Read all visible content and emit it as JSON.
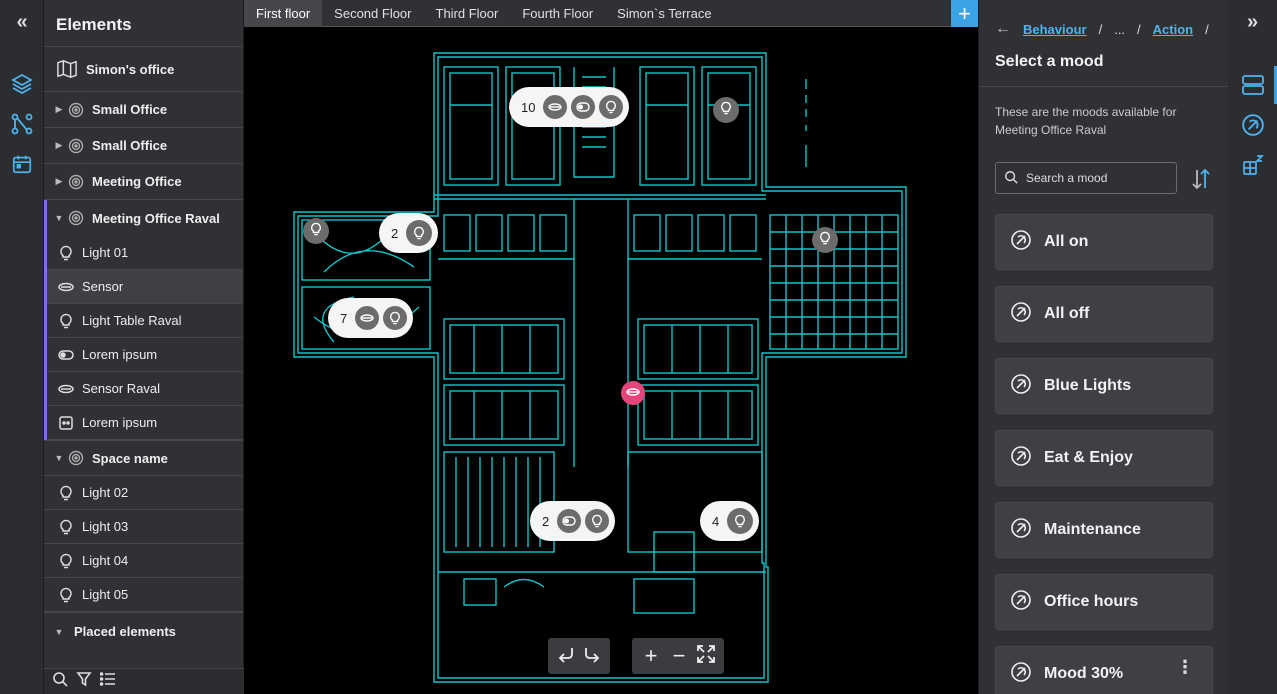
{
  "left_rail": {
    "collapse_label": "«",
    "icons": [
      "layers-icon",
      "flow-icon",
      "calendar-icon"
    ]
  },
  "elements": {
    "title": "Elements",
    "root": {
      "label": "Simon's office",
      "icon": "map-icon"
    },
    "items": [
      {
        "label": "Small Office",
        "kind": "space",
        "expanded": false
      },
      {
        "label": "Small Office",
        "kind": "space",
        "expanded": false
      },
      {
        "label": "Meeting Office",
        "kind": "space",
        "expanded": false
      },
      {
        "label": "Meeting Office Raval",
        "kind": "space",
        "expanded": true
      },
      {
        "label": "Light 01",
        "kind": "light"
      },
      {
        "label": "Sensor",
        "kind": "sensor",
        "selected": true
      },
      {
        "label": "Light Table Raval",
        "kind": "light"
      },
      {
        "label": "Lorem ipsum",
        "kind": "switch"
      },
      {
        "label": "Sensor Raval",
        "kind": "sensor"
      },
      {
        "label": "Lorem ipsum",
        "kind": "device"
      },
      {
        "label": "Space name",
        "kind": "space",
        "expanded": true
      },
      {
        "label": "Light 02",
        "kind": "light"
      },
      {
        "label": "Light 03",
        "kind": "light"
      },
      {
        "label": "Light 04",
        "kind": "light"
      },
      {
        "label": "Light 05",
        "kind": "light"
      },
      {
        "label": "Placed elements",
        "kind": "group",
        "expanded": true
      }
    ]
  },
  "tabs": {
    "items": [
      "First floor",
      "Second Floor",
      "Third Floor",
      "Fourth Floor",
      "Simon`s Terrace"
    ],
    "active": 0,
    "add_label": "+"
  },
  "map": {
    "clusters": [
      {
        "count": "10"
      },
      {
        "count": "2"
      },
      {
        "count": "7"
      },
      {
        "count": "2"
      },
      {
        "count": "4"
      }
    ],
    "controls": {
      "undo": "undo-icon",
      "redo": "redo-icon",
      "zoom_in": "+",
      "zoom_out": "−",
      "fit": "fit-screen-icon"
    }
  },
  "right_panel": {
    "breadcrumb": {
      "back": "←",
      "item1": "Behaviour",
      "sep": "/",
      "ellipsis": "...",
      "item2": "Action"
    },
    "title": "Select a mood",
    "description": "These are the moods available for Meeting Office Raval",
    "search_placeholder": "Search a mood",
    "moods": [
      "All on",
      "All off",
      "Blue Lights",
      "Eat & Enjoy",
      "Maintenance",
      "Office hours",
      "Mood 30%"
    ],
    "accent": "#4fb3f0"
  },
  "right_rail": {
    "expand_label": "»",
    "icons": [
      "panels-icon",
      "mood-icon",
      "scenes-icon"
    ]
  }
}
